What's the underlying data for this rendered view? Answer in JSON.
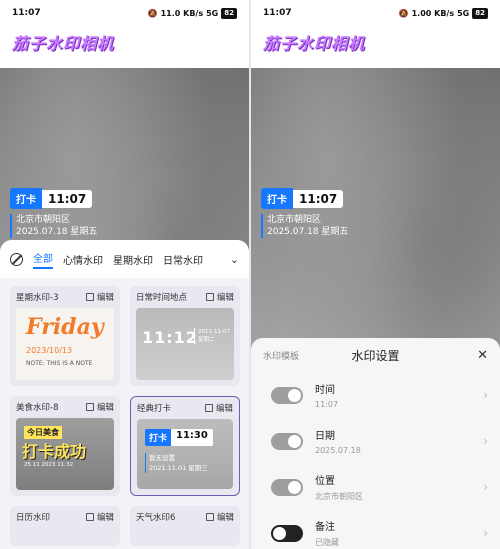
{
  "status": {
    "time": "11:07",
    "left_net": "11.0 KB/s",
    "right_net": "1.00 KB/s",
    "signal": "5G",
    "battery": "82"
  },
  "app_title": "茄子水印相机",
  "watermark": {
    "badge": "打卡",
    "time": "11:07",
    "location": "北京市朝阳区",
    "date": "2025.07.18",
    "weekday": "星期五"
  },
  "left_sheet": {
    "tabs": [
      "全部",
      "心情水印",
      "星期水印",
      "日常水印"
    ],
    "edit_label": "编辑",
    "cards": [
      {
        "name": "星期水印-3",
        "line1": "Friday",
        "line2": "2023/10/13",
        "line3": "NOTE: THIS IS A NOTE"
      },
      {
        "name": "日常时间地点",
        "line1": "11:12",
        "line2": "2011-11-07",
        "line3": "星期二"
      },
      {
        "name": "美食水印-8",
        "line1": "今日美食",
        "line2": "打卡成功",
        "line3": "25.11 2023 11:32"
      },
      {
        "name": "经典打卡",
        "line1": "打卡",
        "line2": "11:30",
        "line3": "暂无设置",
        "line4": "2021.11.01 星期三"
      },
      {
        "name": "日历水印"
      },
      {
        "name": "天气水印6"
      }
    ]
  },
  "right_sheet": {
    "tab_label": "水印模板",
    "title": "水印设置",
    "close": "✕",
    "settings": [
      {
        "name": "时间",
        "value": "11:07",
        "on": true
      },
      {
        "name": "日期",
        "value": "2025.07.18",
        "on": true
      },
      {
        "name": "位置",
        "value": "北京市朝阳区",
        "on": true
      },
      {
        "name": "备注",
        "value": "已隐藏",
        "on": false
      }
    ]
  },
  "colors": {
    "accent": "#1677ff",
    "title": "#c77dff",
    "friday": "#f07c2a"
  }
}
